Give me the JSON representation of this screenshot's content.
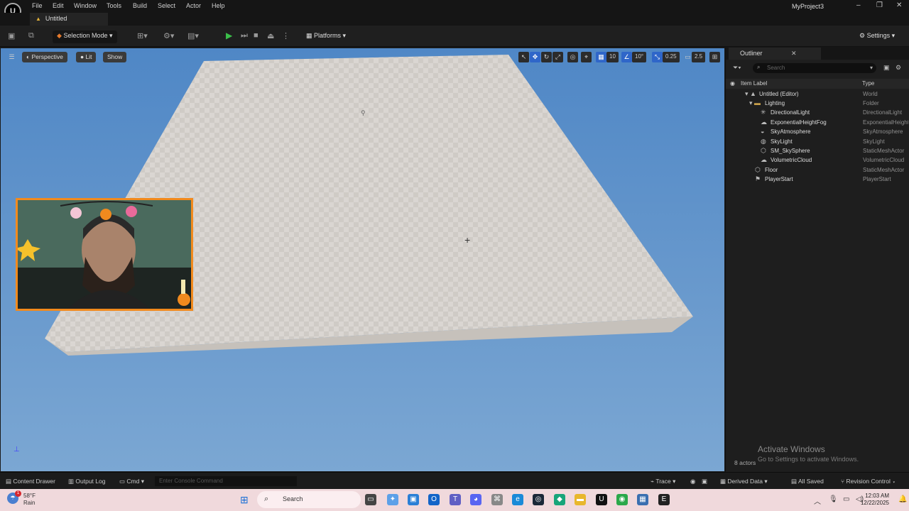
{
  "menu": {
    "items": [
      "File",
      "Edit",
      "Window",
      "Tools",
      "Build",
      "Select",
      "Actor",
      "Help"
    ],
    "project": "MyProject3"
  },
  "tab": {
    "label": "Untitled"
  },
  "toolbar": {
    "mode": "Selection Mode",
    "platforms": "Platforms",
    "settings": "Settings"
  },
  "viewport": {
    "perspective": "Perspective",
    "lit": "Lit",
    "show": "Show",
    "grid": "10",
    "angle": "10°",
    "scale": "0.25",
    "cam": "2.5"
  },
  "outliner": {
    "title": "Outliner",
    "search_placeholder": "Search",
    "col_label": "Item Label",
    "col_type": "Type",
    "rows": [
      {
        "label": "Untitled (Editor)",
        "type": "World"
      },
      {
        "label": "Lighting",
        "type": "Folder"
      },
      {
        "label": "DirectionalLight",
        "type": "DirectionalLight"
      },
      {
        "label": "ExponentialHeightFog",
        "type": "ExponentialHeightFog"
      },
      {
        "label": "SkyAtmosphere",
        "type": "SkyAtmosphere"
      },
      {
        "label": "SkyLight",
        "type": "SkyLight"
      },
      {
        "label": "SM_SkySphere",
        "type": "StaticMeshActor"
      },
      {
        "label": "VolumetricCloud",
        "type": "VolumetricCloud"
      },
      {
        "label": "Floor",
        "type": "StaticMeshActor"
      },
      {
        "label": "PlayerStart",
        "type": "PlayerStart"
      }
    ],
    "actor_count": "8 actors",
    "activate_title": "Activate Windows",
    "activate_sub": "Go to Settings to activate Windows."
  },
  "statusbar": {
    "content_drawer": "Content Drawer",
    "output_log": "Output Log",
    "cmd": "Cmd",
    "console_placeholder": "Enter Console Command",
    "trace": "Trace",
    "derived": "Derived Data",
    "saved": "All Saved",
    "revision": "Revision Control"
  },
  "taskbar": {
    "temp": "58°F",
    "weather": "Rain",
    "search": "Search",
    "time": "12:03 AM",
    "date": "12/22/2025",
    "notif": "1"
  },
  "colors": {
    "accent": "#2f66c9",
    "play": "#3bbf4a",
    "webcam_border": "#f28a1d",
    "sky": "#6a9acd"
  }
}
